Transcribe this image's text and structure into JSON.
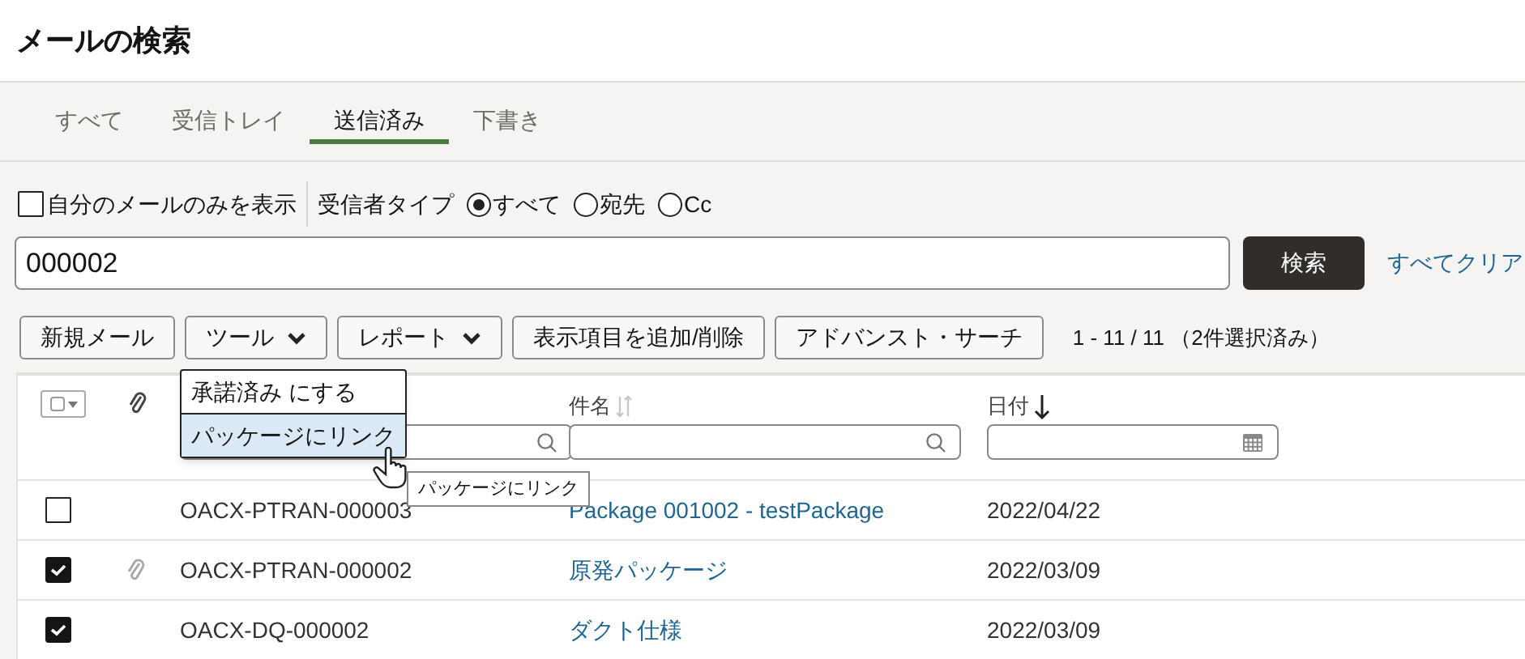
{
  "page": {
    "title": "メールの検索"
  },
  "tabs": [
    {
      "label": "すべて",
      "selected": false
    },
    {
      "label": "受信トレイ",
      "selected": false
    },
    {
      "label": "送信済み",
      "selected": true
    },
    {
      "label": "下書き",
      "selected": false
    }
  ],
  "filters": {
    "own_mail_only": {
      "label": "自分のメールのみを表示",
      "checked": false
    },
    "recipient_type": {
      "label": "受信者タイプ",
      "options": [
        {
          "label": "すべて",
          "selected": true
        },
        {
          "label": "宛先",
          "selected": false
        },
        {
          "label": "Cc",
          "selected": false
        }
      ]
    }
  },
  "search": {
    "value": "000002",
    "button": "検索",
    "clear_link": "すべてクリア"
  },
  "toolbar": {
    "buttons": [
      {
        "label": "新規メール",
        "kind": "plain"
      },
      {
        "label": "ツール",
        "kind": "dropdown"
      },
      {
        "label": "レポート",
        "kind": "dropdown"
      },
      {
        "label": "表示項目を追加/削除",
        "kind": "plain"
      },
      {
        "label": "アドバンスト・サーチ",
        "kind": "plain"
      }
    ],
    "range": "1 - 11 / 11 （2件選択済み）"
  },
  "menu": {
    "items": [
      {
        "label": "承諾済み にする",
        "selected": false
      },
      {
        "label": "パッケージにリンク",
        "selected": true
      }
    ]
  },
  "tooltip": "パッケージにリンク",
  "table": {
    "columns": [
      {
        "label": "件名",
        "sorted": false,
        "kind": "search"
      },
      {
        "label": "日付",
        "sorted": true,
        "kind": "date"
      }
    ],
    "rows": [
      {
        "checked": false,
        "attachment": false,
        "column_3": "OACX-PTRAN-000003",
        "subject": "Package 001002 - testPackage",
        "date": "2022/04/22"
      },
      {
        "checked": true,
        "attachment": true,
        "column_3": "OACX-PTRAN-000002",
        "subject": "原発パッケージ",
        "date": "2022/03/09"
      },
      {
        "checked": true,
        "attachment": false,
        "column_3": "OACX-DQ-000002",
        "subject": "ダクト仕様",
        "date": "2022/03/09"
      }
    ]
  }
}
